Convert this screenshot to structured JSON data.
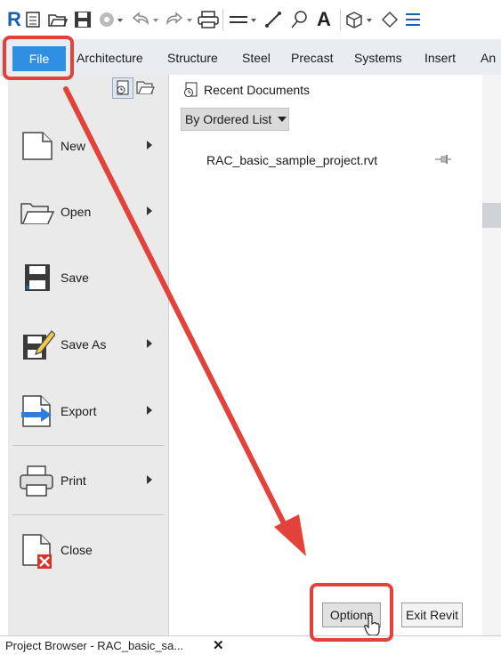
{
  "qat": {
    "logo_letter": "R"
  },
  "tabs": {
    "file": "File",
    "items": [
      "Architecture",
      "Structure",
      "Steel",
      "Precast",
      "Systems",
      "Insert",
      "An"
    ]
  },
  "menu": {
    "new": "New",
    "open": "Open",
    "save": "Save",
    "save_as": "Save As",
    "export": "Export",
    "print": "Print",
    "close": "Close"
  },
  "recent": {
    "title": "Recent Documents",
    "sort_value": "By Ordered List",
    "files": [
      "RAC_basic_sample_project.rvt"
    ]
  },
  "buttons": {
    "options": "Options",
    "exit": "Exit Revit"
  },
  "bottom": {
    "tab_label": "Project Browser - RAC_basic_sa...",
    "close_glyph": "✕"
  },
  "colors": {
    "accent": "#2f8fe0",
    "callout": "#e3423a",
    "revit_blue": "#1a5fb4"
  }
}
